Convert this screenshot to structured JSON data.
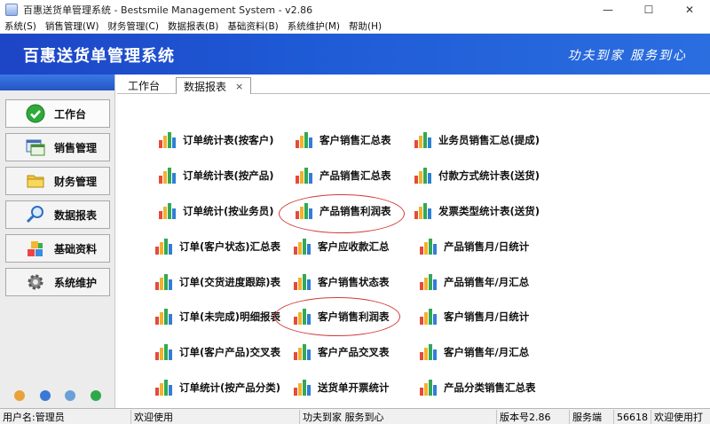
{
  "window": {
    "title": "百惠送货单管理系统 - Bestsmile Management System - v2.86",
    "minimize_glyph": "—",
    "maximize_glyph": "☐",
    "close_glyph": "✕"
  },
  "menu": {
    "items": [
      {
        "label": "系统(S)"
      },
      {
        "label": "销售管理(W)"
      },
      {
        "label": "财务管理(C)"
      },
      {
        "label": "数据报表(B)"
      },
      {
        "label": "基础资料(B)"
      },
      {
        "label": "系统维护(M)"
      },
      {
        "label": "帮助(H)"
      }
    ]
  },
  "banner": {
    "title": "百惠送货单管理系统",
    "slogan": "功夫到家 服务到心"
  },
  "sidebar": {
    "items": [
      {
        "label": "工作台",
        "icon": "check-icon"
      },
      {
        "label": "销售管理",
        "icon": "window-icon"
      },
      {
        "label": "财务管理",
        "icon": "folder-icon"
      },
      {
        "label": "数据报表",
        "icon": "magnifier-icon"
      },
      {
        "label": "基础资料",
        "icon": "blocks-icon"
      },
      {
        "label": "系统维护",
        "icon": "gear-icon"
      }
    ]
  },
  "tabs": [
    {
      "label": "工作台"
    },
    {
      "label": "数据报表",
      "close": "×"
    }
  ],
  "reports": {
    "col1": [
      "订单统计表(按客户)",
      "订单统计表(按产品)",
      "订单统计(按业务员)",
      "订单(客户状态)汇总表",
      "订单(交货进度跟踪)表",
      "订单(未完成)明细报表",
      "订单(客户产品)交叉表",
      "订单统计(按产品分类)"
    ],
    "col2": [
      "客户销售汇总表",
      "产品销售汇总表",
      "产品销售利润表",
      "客户应收款汇总",
      "客户销售状态表",
      "客户销售利润表",
      "客户产品交叉表",
      "送货单开票统计"
    ],
    "col3": [
      "业务员销售汇总(提成)",
      "付款方式统计表(送货)",
      "发票类型统计表(送货)",
      "产品销售月/日统计",
      "产品销售年/月汇总",
      "客户销售月/日统计",
      "客户销售年/月汇总",
      "产品分类销售汇总表"
    ]
  },
  "colors": {
    "banner": "#1f5bd6",
    "highlight": "#d23a3a"
  },
  "status": {
    "user": "用户名:管理员",
    "welcome": "欢迎使用",
    "slogan": "功夫到家 服务到心",
    "version": "版本号2.86",
    "server_label": "服务端",
    "server_port": "56618",
    "welcome2": "欢迎使用打"
  }
}
